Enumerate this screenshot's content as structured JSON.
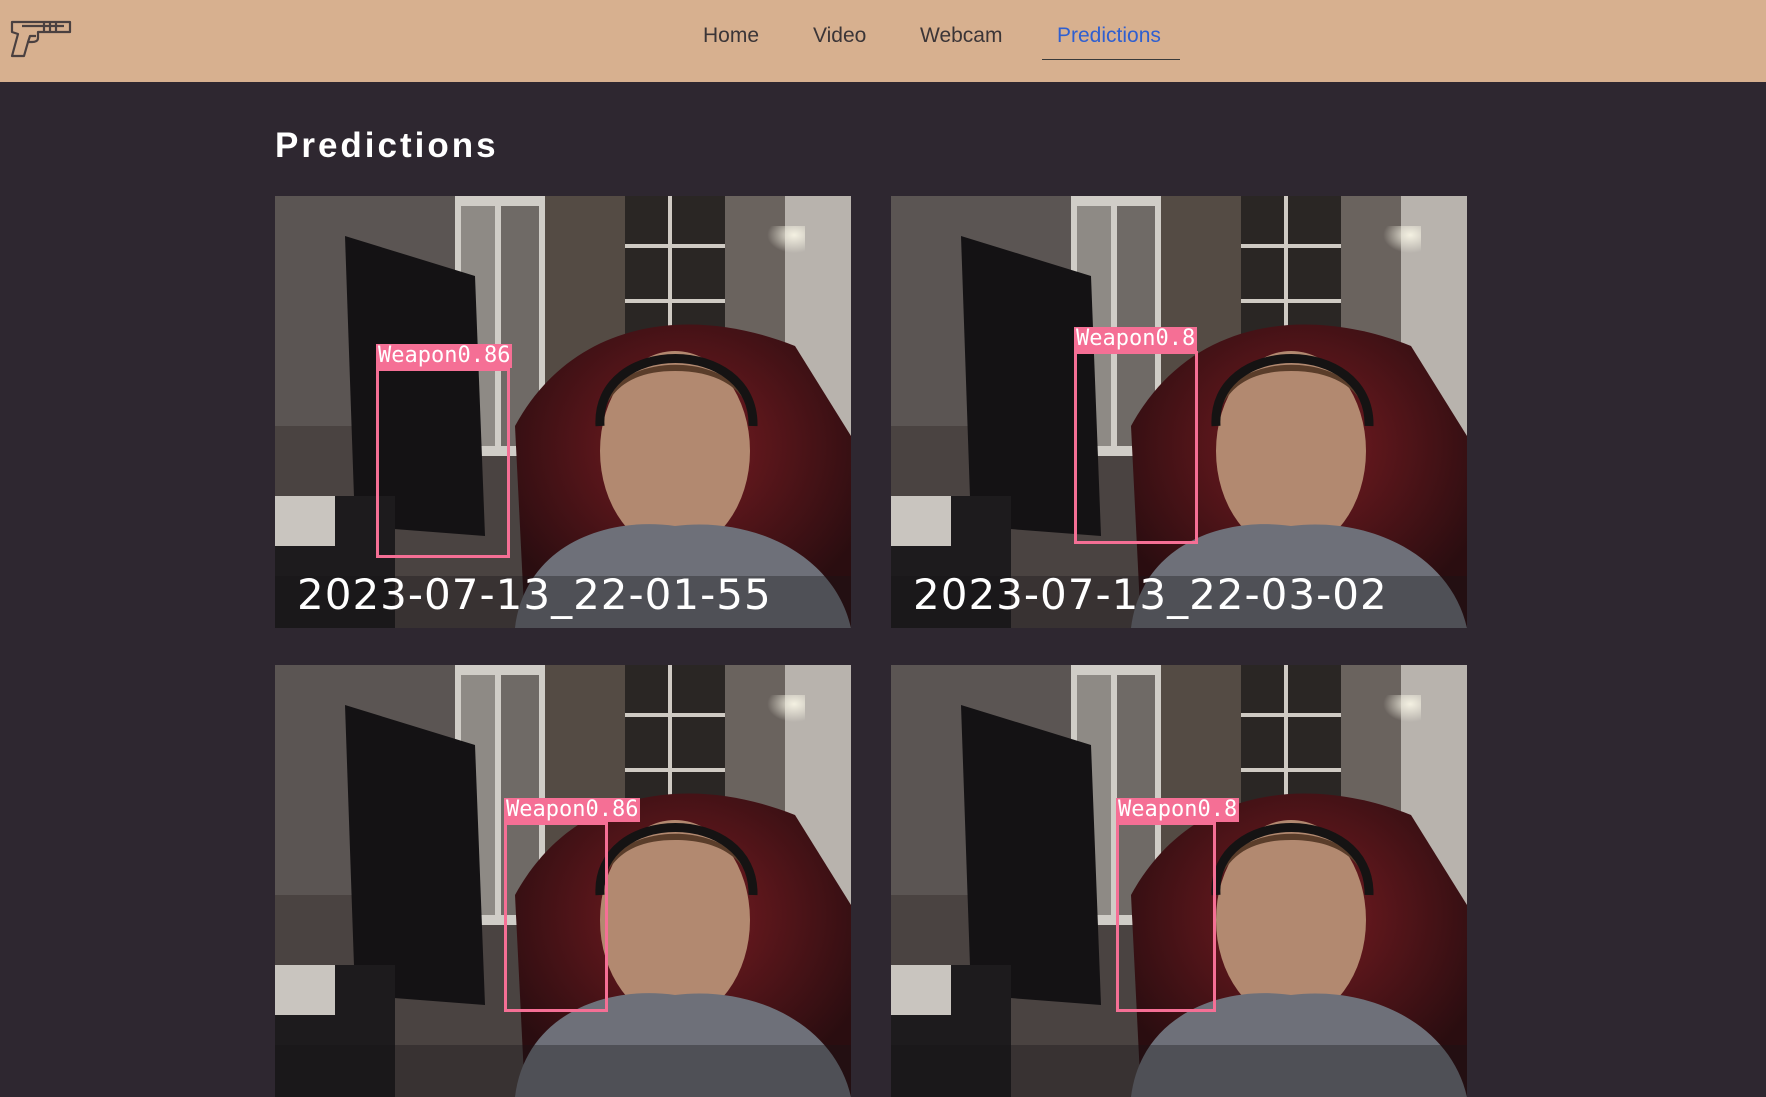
{
  "nav": {
    "logo_icon": "pistol-icon",
    "items": [
      {
        "label": "Home"
      },
      {
        "label": "Video"
      },
      {
        "label": "Webcam"
      },
      {
        "label": "Predictions",
        "active": true
      }
    ],
    "active_color": "#2f5fd0"
  },
  "page": {
    "title": "Predictions"
  },
  "predictions": [
    {
      "label": "Weapon0.86",
      "timestamp": "2023-07-13_22-01-55"
    },
    {
      "label": "Weapon0.8",
      "timestamp": "2023-07-13_22-03-02"
    },
    {
      "label": "Weapon0.86",
      "timestamp": ""
    },
    {
      "label": "Weapon0.8",
      "timestamp": ""
    }
  ],
  "colors": {
    "navbar": "#d7b08f",
    "background": "#2e2730",
    "detection": "#f56f95"
  }
}
